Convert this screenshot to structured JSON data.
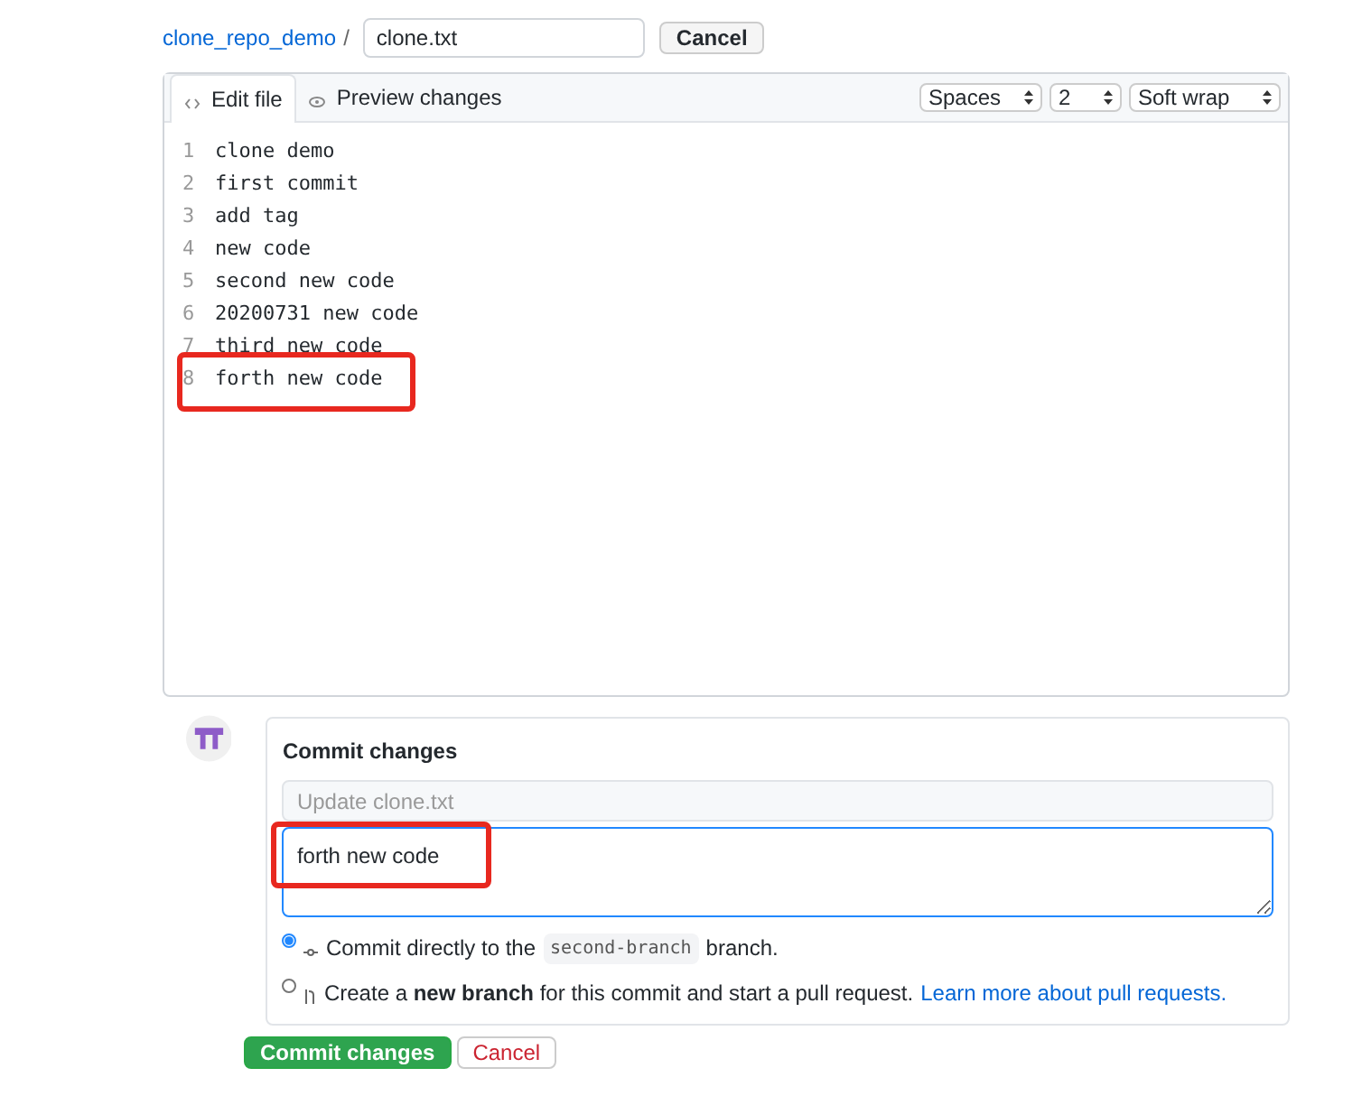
{
  "breadcrumb": {
    "repo": "clone_repo_demo",
    "separator": "/",
    "filename": "clone.txt",
    "cancel": "Cancel"
  },
  "tabs": [
    {
      "label": "Edit file",
      "kind": "edit",
      "selected": true
    },
    {
      "label": "Preview changes",
      "kind": "preview",
      "selected": false
    }
  ],
  "options": [
    {
      "value": "Spaces"
    },
    {
      "value": "2"
    },
    {
      "value": "Soft wrap"
    }
  ],
  "lines": [
    {
      "number": "1",
      "text": "clone demo",
      "highlighted": false
    },
    {
      "number": "2",
      "text": "first commit",
      "highlighted": false
    },
    {
      "number": "3",
      "text": "add tag",
      "highlighted": false
    },
    {
      "number": "4",
      "text": "new code",
      "highlighted": false
    },
    {
      "number": "5",
      "text": "second new code",
      "highlighted": false
    },
    {
      "number": "6",
      "text": "20200731 new code",
      "highlighted": false
    },
    {
      "number": "7",
      "text": "third new code",
      "highlighted": false
    },
    {
      "number": "8",
      "text": "forth new code",
      "highlighted": true
    }
  ],
  "commit": {
    "title": "Commit changes",
    "summary_placeholder": "Update clone.txt",
    "description": "forth new code",
    "description_highlighted": true,
    "choices": [
      {
        "kind": "direct",
        "selected": true,
        "before": "Commit directly to the",
        "branch": "second-branch",
        "after": "branch."
      },
      {
        "kind": "new",
        "selected": false,
        "text": "Create a **new branch** for this commit and start a pull request.",
        "link": "Learn more about pull requests."
      }
    ]
  },
  "buttons": [
    {
      "kind": "primary",
      "label": "Commit changes"
    },
    {
      "kind": "danger",
      "label": "Cancel"
    }
  ]
}
